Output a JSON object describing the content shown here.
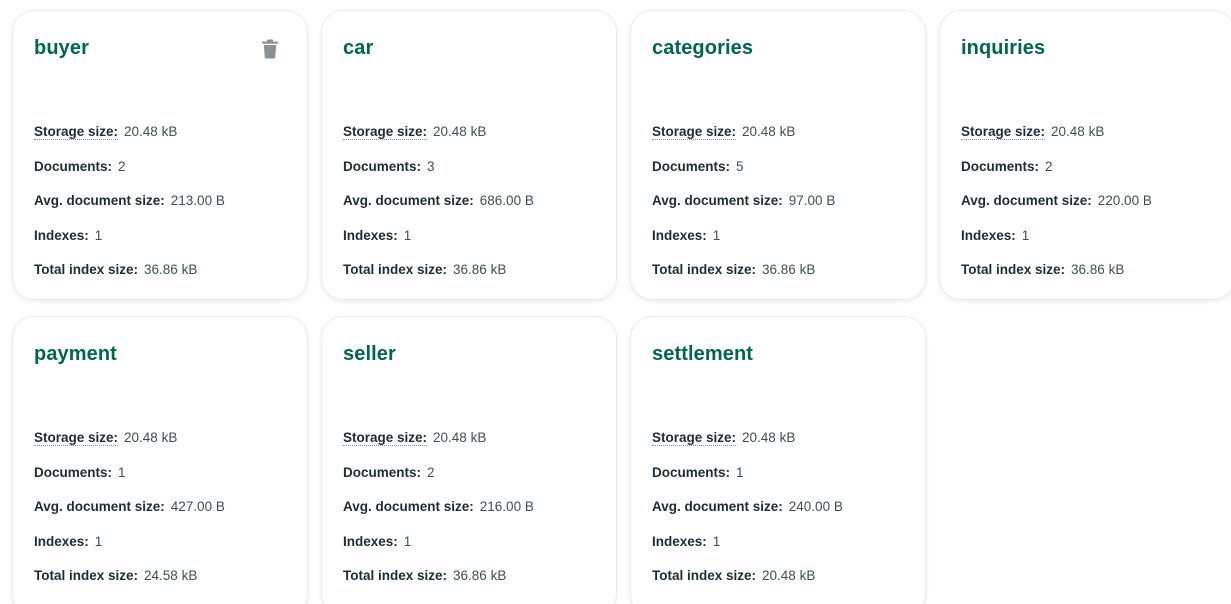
{
  "labels": {
    "storage_size": "Storage size:",
    "documents": "Documents:",
    "avg_document_size": "Avg. document size:",
    "indexes": "Indexes:",
    "total_index_size": "Total index size:"
  },
  "colors": {
    "title": "#00684a",
    "label": "#1c2d38",
    "value": "#3d4f58",
    "trash_icon": "#889397"
  },
  "collections": [
    {
      "name": "buyer",
      "storage_size": "20.48 kB",
      "documents": "2",
      "avg_document_size": "213.00 B",
      "indexes": "1",
      "total_index_size": "36.86 kB",
      "show_delete_icon": true
    },
    {
      "name": "car",
      "storage_size": "20.48 kB",
      "documents": "3",
      "avg_document_size": "686.00 B",
      "indexes": "1",
      "total_index_size": "36.86 kB"
    },
    {
      "name": "categories",
      "storage_size": "20.48 kB",
      "documents": "5",
      "avg_document_size": "97.00 B",
      "indexes": "1",
      "total_index_size": "36.86 kB"
    },
    {
      "name": "inquiries",
      "storage_size": "20.48 kB",
      "documents": "2",
      "avg_document_size": "220.00 B",
      "indexes": "1",
      "total_index_size": "36.86 kB"
    },
    {
      "name": "payment",
      "storage_size": "20.48 kB",
      "documents": "1",
      "avg_document_size": "427.00 B",
      "indexes": "1",
      "total_index_size": "24.58 kB"
    },
    {
      "name": "seller",
      "storage_size": "20.48 kB",
      "documents": "2",
      "avg_document_size": "216.00 B",
      "indexes": "1",
      "total_index_size": "36.86 kB"
    },
    {
      "name": "settlement",
      "storage_size": "20.48 kB",
      "documents": "1",
      "avg_document_size": "240.00 B",
      "indexes": "1",
      "total_index_size": "20.48 kB"
    }
  ]
}
